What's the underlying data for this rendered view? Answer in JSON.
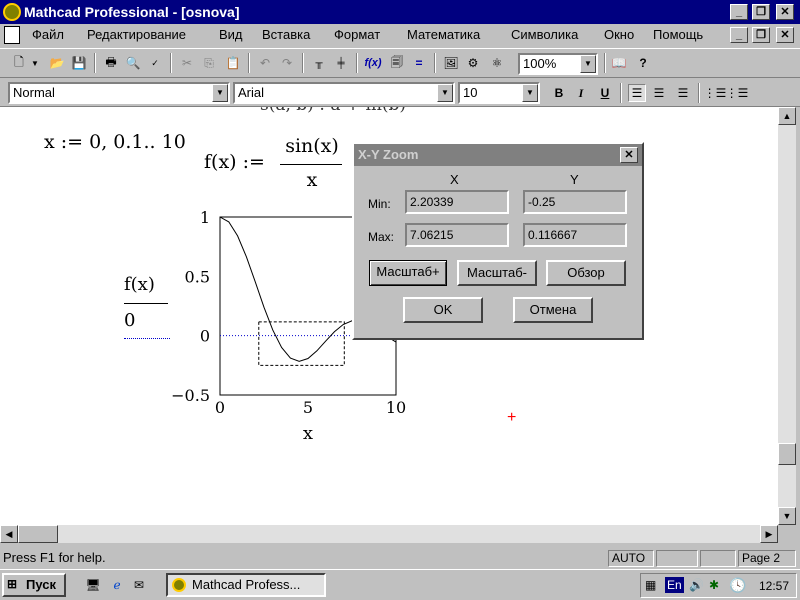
{
  "window": {
    "title": "Mathcad Professional - [osnova]"
  },
  "menu": {
    "items": [
      "Файл",
      "Редактирование",
      "Вид",
      "Вставка",
      "Формат",
      "Математика",
      "Символика",
      "Окно",
      "Помощь"
    ]
  },
  "toolbar": {
    "zoom": "100%"
  },
  "format_bar": {
    "style": "Normal",
    "font": "Arial",
    "size": "10",
    "bold": "B",
    "italic": "I",
    "underline": "U"
  },
  "worksheet": {
    "range_def": "x := 0, 0.1.. 10",
    "func_lhs": "f(x) :=",
    "func_num": "sin(x)",
    "func_den": "x",
    "partial_top": "s(a, b) :    a + in(b)",
    "plot": {
      "y_label_top": "f(x)",
      "y_label_bottom": "0",
      "x_label": "x",
      "y_ticks": [
        "1",
        "0.5",
        "0",
        "−0.5"
      ],
      "x_ticks": [
        "0",
        "5",
        "10"
      ]
    }
  },
  "chart_data": {
    "type": "line",
    "title": "",
    "xlabel": "x",
    "ylabel": "f(x)",
    "xlim": [
      0,
      10
    ],
    "ylim": [
      -0.5,
      1
    ],
    "grid": false,
    "series": [
      {
        "name": "f(x)",
        "x": [
          0,
          0.5,
          1,
          1.5,
          2,
          2.5,
          3,
          3.5,
          4,
          4.5,
          5,
          5.5,
          6,
          6.5,
          7,
          7.5,
          8,
          8.5,
          9,
          9.5,
          10
        ],
        "values": [
          1,
          0.959,
          0.841,
          0.665,
          0.455,
          0.239,
          0.047,
          -0.1,
          -0.189,
          -0.217,
          -0.192,
          -0.128,
          -0.047,
          0.033,
          0.094,
          0.125,
          0.124,
          0.094,
          0.046,
          -0.008,
          -0.054
        ]
      },
      {
        "name": "0",
        "x": [
          0,
          10
        ],
        "values": [
          0,
          0
        ]
      }
    ],
    "zoom_box": {
      "x": [
        2.20339,
        7.06215
      ],
      "y": [
        -0.25,
        0.116667
      ]
    }
  },
  "dialog": {
    "title": "X-Y Zoom",
    "col_x": "X",
    "col_y": "Y",
    "min_label": "Min:",
    "max_label": "Max:",
    "min_x": "2.20339",
    "min_y": "-0.25",
    "max_x": "7.06215",
    "max_y": "0.116667",
    "zoom_in": "Масштаб+",
    "zoom_out": "Масштаб-",
    "full_view": "Обзор",
    "ok": "OK",
    "cancel": "Отмена"
  },
  "status": {
    "help": "Press F1 for help.",
    "mode": "AUTO",
    "page": "Page 2"
  },
  "taskbar": {
    "start": "Пуск",
    "task": "Mathcad Profess...",
    "lang": "En",
    "clock": "12:57"
  },
  "colors": {
    "title_active": "#000080",
    "title_inactive": "#808080",
    "face": "#c0c0c0",
    "zero_line": "#0000cc",
    "cursor_mark": "#ff0000"
  }
}
